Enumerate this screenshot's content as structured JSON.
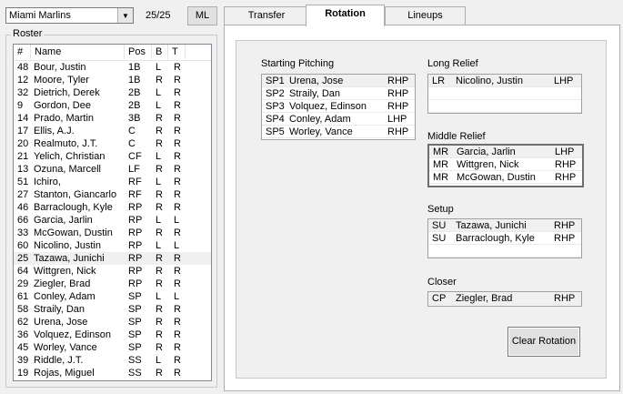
{
  "team_select": {
    "value": "Miami Marlins"
  },
  "roster_count": "25/25",
  "ml_button": "ML",
  "roster": {
    "label": "Roster",
    "columns": [
      "#",
      "Name",
      "Pos",
      "B",
      "T"
    ],
    "rows": [
      {
        "num": "48",
        "name": "Bour, Justin",
        "pos": "1B",
        "b": "L",
        "t": "R"
      },
      {
        "num": "12",
        "name": "Moore, Tyler",
        "pos": "1B",
        "b": "R",
        "t": "R"
      },
      {
        "num": "32",
        "name": "Dietrich, Derek",
        "pos": "2B",
        "b": "L",
        "t": "R"
      },
      {
        "num": "9",
        "name": "Gordon, Dee",
        "pos": "2B",
        "b": "L",
        "t": "R"
      },
      {
        "num": "14",
        "name": "Prado, Martin",
        "pos": "3B",
        "b": "R",
        "t": "R"
      },
      {
        "num": "17",
        "name": "Ellis, A.J.",
        "pos": "C",
        "b": "R",
        "t": "R"
      },
      {
        "num": "20",
        "name": "Realmuto, J.T.",
        "pos": "C",
        "b": "R",
        "t": "R"
      },
      {
        "num": "21",
        "name": "Yelich, Christian",
        "pos": "CF",
        "b": "L",
        "t": "R"
      },
      {
        "num": "13",
        "name": "Ozuna, Marcell",
        "pos": "LF",
        "b": "R",
        "t": "R"
      },
      {
        "num": "51",
        "name": "Ichiro,",
        "pos": "RF",
        "b": "L",
        "t": "R"
      },
      {
        "num": "27",
        "name": "Stanton, Giancarlo",
        "pos": "RF",
        "b": "R",
        "t": "R"
      },
      {
        "num": "46",
        "name": "Barraclough, Kyle",
        "pos": "RP",
        "b": "R",
        "t": "R"
      },
      {
        "num": "66",
        "name": "Garcia, Jarlin",
        "pos": "RP",
        "b": "L",
        "t": "L"
      },
      {
        "num": "33",
        "name": "McGowan, Dustin",
        "pos": "RP",
        "b": "R",
        "t": "R"
      },
      {
        "num": "60",
        "name": "Nicolino, Justin",
        "pos": "RP",
        "b": "L",
        "t": "L"
      },
      {
        "num": "25",
        "name": "Tazawa, Junichi",
        "pos": "RP",
        "b": "R",
        "t": "R"
      },
      {
        "num": "64",
        "name": "Wittgren, Nick",
        "pos": "RP",
        "b": "R",
        "t": "R"
      },
      {
        "num": "29",
        "name": "Ziegler, Brad",
        "pos": "RP",
        "b": "R",
        "t": "R"
      },
      {
        "num": "61",
        "name": "Conley, Adam",
        "pos": "SP",
        "b": "L",
        "t": "L"
      },
      {
        "num": "58",
        "name": "Straily, Dan",
        "pos": "SP",
        "b": "R",
        "t": "R"
      },
      {
        "num": "62",
        "name": "Urena, Jose",
        "pos": "SP",
        "b": "R",
        "t": "R"
      },
      {
        "num": "36",
        "name": "Volquez, Edinson",
        "pos": "SP",
        "b": "R",
        "t": "R"
      },
      {
        "num": "45",
        "name": "Worley, Vance",
        "pos": "SP",
        "b": "R",
        "t": "R"
      },
      {
        "num": "39",
        "name": "Riddle, J.T.",
        "pos": "SS",
        "b": "L",
        "t": "R"
      },
      {
        "num": "19",
        "name": "Rojas, Miguel",
        "pos": "SS",
        "b": "R",
        "t": "R"
      }
    ]
  },
  "tabs": [
    {
      "label": "Transfer"
    },
    {
      "label": "Rotation"
    },
    {
      "label": "Lineups"
    }
  ],
  "starting_pitching": {
    "title": "Starting Pitching",
    "rows": [
      {
        "slot": "SP1",
        "name": "Urena, Jose",
        "hand": "RHP"
      },
      {
        "slot": "SP2",
        "name": "Straily, Dan",
        "hand": "RHP"
      },
      {
        "slot": "SP3",
        "name": "Volquez, Edinson",
        "hand": "RHP"
      },
      {
        "slot": "SP4",
        "name": "Conley, Adam",
        "hand": "LHP"
      },
      {
        "slot": "SP5",
        "name": "Worley, Vance",
        "hand": "RHP"
      }
    ]
  },
  "long_relief": {
    "title": "Long Relief",
    "rows": [
      {
        "slot": "LR",
        "name": "Nicolino, Justin",
        "hand": "LHP"
      }
    ]
  },
  "middle_relief": {
    "title": "Middle Relief",
    "rows": [
      {
        "slot": "MR",
        "name": "Garcia, Jarlin",
        "hand": "LHP"
      },
      {
        "slot": "MR",
        "name": "Wittgren, Nick",
        "hand": "RHP"
      },
      {
        "slot": "MR",
        "name": "McGowan, Dustin",
        "hand": "RHP"
      }
    ]
  },
  "setup": {
    "title": "Setup",
    "rows": [
      {
        "slot": "SU",
        "name": "Tazawa, Junichi",
        "hand": "RHP"
      },
      {
        "slot": "SU",
        "name": "Barraclough, Kyle",
        "hand": "RHP"
      }
    ]
  },
  "closer": {
    "title": "Closer",
    "rows": [
      {
        "slot": "CP",
        "name": "Ziegler, Brad",
        "hand": "RHP"
      }
    ]
  },
  "clear_button": "Clear Rotation"
}
